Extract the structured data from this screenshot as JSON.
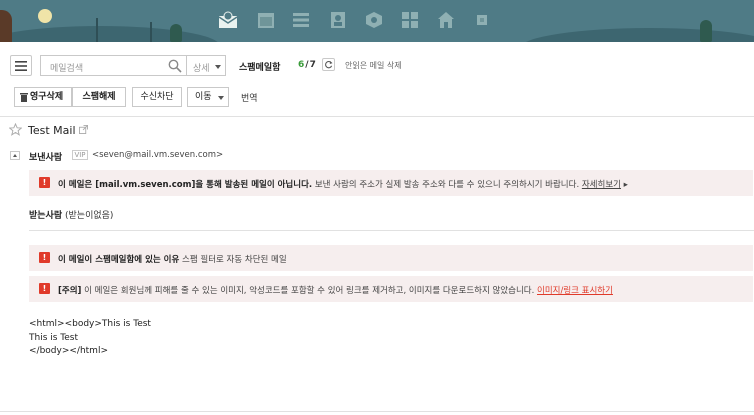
{
  "toolbar": {
    "search_placeholder": "메일검색",
    "detail_label": "상세",
    "mailbox_title": "스팸메일함",
    "unread_count": "6",
    "total_count": "7",
    "delete_unread": "안읽은 메일 삭제"
  },
  "actions": {
    "delete_permanent": "영구삭제",
    "unspam": "스팸해제",
    "block": "수신차단",
    "move": "이동",
    "translate": "번역"
  },
  "mail": {
    "subject": "Test Mail",
    "sender_label": "보낸사람",
    "vip_badge": "VIP",
    "sender_address": "<seven@mail.vm.seven.com>",
    "warning_bold": "이 메일은 [mail.vm.seven.com]을 통해 발송된 메일이 아닙니다.",
    "warning_rest": " 보낸 사람의 주소가 실제 발송 주소와 다를 수 있으니 주의하시기 바랍니다.",
    "warning_link": "자세히보기",
    "receiver_label": "받는사람",
    "receiver_value": "(받는이없음)",
    "spam_reason_bold": "이 메일이 스팸메일함에 있는 이유",
    "spam_reason_rest": " 스팸 필터로 자동 차단된 메일",
    "caution_bold": "[주의]",
    "caution_rest": " 이 메일은 회원님께 피해를 줄 수 있는 이미지, 악성코드를 포함할 수 있어 링크를 제거하고, 이미지를 다운로드하지 않았습니다.",
    "caution_link": "이미지/링크 표시하기",
    "body_lines": [
      "<html><body>This is Test",
      "This is Test",
      "</body></html>"
    ]
  },
  "icons": {
    "top_apps": [
      "mail-icon",
      "calendar-icon",
      "list-icon",
      "contacts-icon",
      "box-icon",
      "grid-icon",
      "home-icon",
      "square-icon"
    ]
  }
}
